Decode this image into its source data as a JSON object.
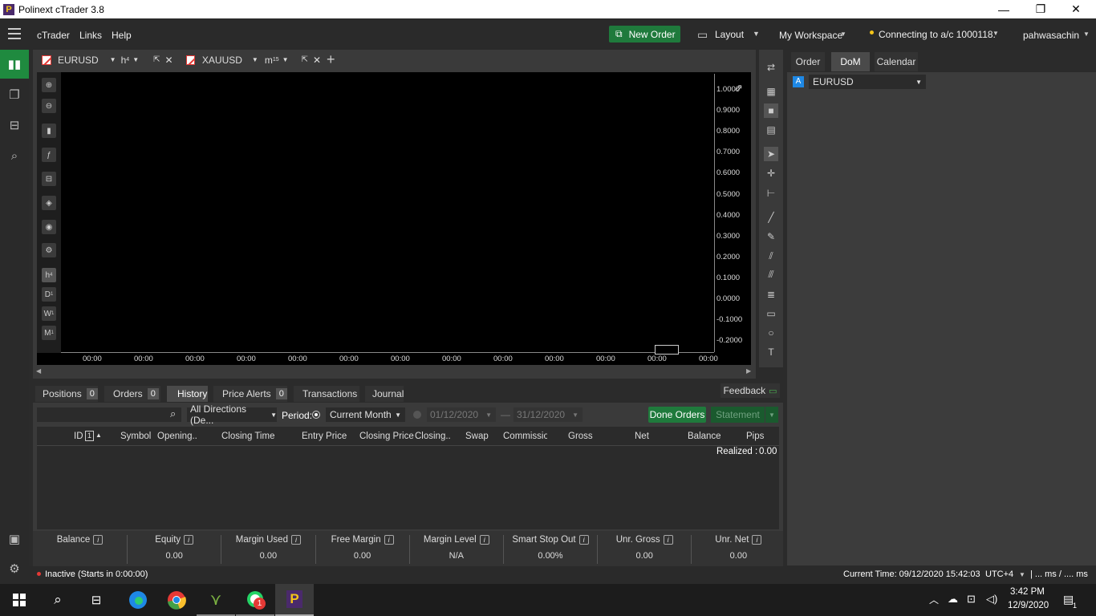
{
  "titlebar": {
    "title": "Polinext cTrader 3.8",
    "logo_letter": "P",
    "minimize": "—",
    "restore": "❐",
    "close": "✕"
  },
  "menu": {
    "ctrader": "cTrader",
    "links": "Links",
    "help": "Help",
    "new_order": "New Order",
    "layout": "Layout",
    "workspace": "My Workspace",
    "connection": "Connecting to a/c 1000118.",
    "user": "pahwasachin"
  },
  "chart_tabs": [
    {
      "symbol": "EURUSD",
      "timeframe": "h",
      "timeframe_sub": "4"
    },
    {
      "symbol": "XAUUSD",
      "timeframe": "m",
      "timeframe_sub": "15"
    }
  ],
  "chart_tools": {
    "h": "h",
    "h_sub": "4",
    "d": "D",
    "d_sub": "1",
    "w": "W",
    "w_sub": "1",
    "m": "M",
    "m_sub": "1"
  },
  "y_axis": [
    "1.0000",
    "0.9000",
    "0.8000",
    "0.7000",
    "0.6000",
    "0.5000",
    "0.4000",
    "0.3000",
    "0.2000",
    "0.1000",
    "0.0000",
    "-0.1000",
    "-0.2000"
  ],
  "x_axis": [
    "00:00",
    "00:00",
    "00:00",
    "00:00",
    "00:00",
    "00:00",
    "00:00",
    "00:00",
    "00:00",
    "00:00",
    "00:00",
    "00:00",
    "00:00"
  ],
  "right_panel": {
    "tabs": [
      "Order",
      "DoM",
      "Calendar"
    ],
    "active_tab": "DoM",
    "symbol_badge": "A",
    "symbol": "EURUSD"
  },
  "bottom_tabs": [
    {
      "label": "Positions",
      "count": "0"
    },
    {
      "label": "Orders",
      "count": "0"
    },
    {
      "label": "History",
      "count": ""
    },
    {
      "label": "Price Alerts",
      "count": "0"
    },
    {
      "label": "Transactions",
      "count": ""
    },
    {
      "label": "Journal",
      "count": ""
    }
  ],
  "feedback": "Feedback",
  "history": {
    "search_placeholder": "",
    "directions": "All Directions (De...",
    "period_label": "Period:",
    "period_value": "Current Month",
    "date_from": "01/12/2020",
    "date_to": "31/12/2020",
    "done_orders": "Done Orders",
    "statement": "Statement",
    "columns": [
      "ID",
      "Symbol",
      "Opening..",
      "Closing Time",
      "Entry Price",
      "Closing Price",
      "Closing..",
      "Swap",
      "Commission",
      "Gross",
      "Net",
      "Balance",
      "Pips"
    ],
    "id_sort_badge": "1",
    "realized_label": "Realized :",
    "realized_value": "0.00"
  },
  "stats": [
    {
      "label": "Balance",
      "value": ""
    },
    {
      "label": "Equity",
      "value": "0.00"
    },
    {
      "label": "Margin Used",
      "value": "0.00"
    },
    {
      "label": "Free Margin",
      "value": "0.00"
    },
    {
      "label": "Margin Level",
      "value": "N/A"
    },
    {
      "label": "Smart Stop Out",
      "value": "0.00%"
    },
    {
      "label": "Unr. Gross",
      "value": "0.00"
    },
    {
      "label": "Unr. Net",
      "value": "0.00"
    }
  ],
  "status": {
    "inactive": "Inactive (Starts in 0:00:00)",
    "current_time": "Current Time: 09/12/2020 15:42:03",
    "tz": "UTC+4",
    "latency": "| ... ms / .... ms"
  },
  "taskbar": {
    "time": "3:42 PM",
    "date": "12/9/2020",
    "whatsapp_badge": "1",
    "notif_badge": "1"
  },
  "colors": {
    "green": "#1f7a3c",
    "accent_blue": "#1e88e5",
    "status_red": "#e53935",
    "connect_yellow": "#f5c518"
  }
}
